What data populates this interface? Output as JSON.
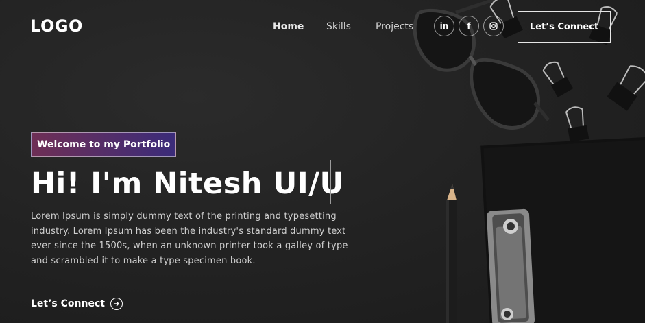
{
  "header": {
    "logo": "LOGO",
    "nav": [
      {
        "label": "Home"
      },
      {
        "label": "Skills"
      },
      {
        "label": "Projects"
      }
    ],
    "social": [
      {
        "label": "in",
        "icon": "linkedin-icon"
      },
      {
        "label": "f",
        "icon": "facebook-icon"
      },
      {
        "label": "",
        "icon": "instagram-icon"
      }
    ],
    "connect_label": "Let’s Connect"
  },
  "hero": {
    "tagline": "Welcome to my Portfolio",
    "headline": "Hi! I'm Nitesh UI/U",
    "description": "Lorem Ipsum is simply dummy text of the printing and typesetting industry. Lorem Ipsum has been the industry's standard dummy text ever since the 1500s, when an unknown printer took a galley of type and scrambled it to make a type specimen book.",
    "cta_label": "Let’s Connect"
  },
  "colors": {
    "background": "#1f1f1f",
    "tagline_gradient_start": "#aa367c",
    "tagline_gradient_end": "#4a2fbd"
  }
}
